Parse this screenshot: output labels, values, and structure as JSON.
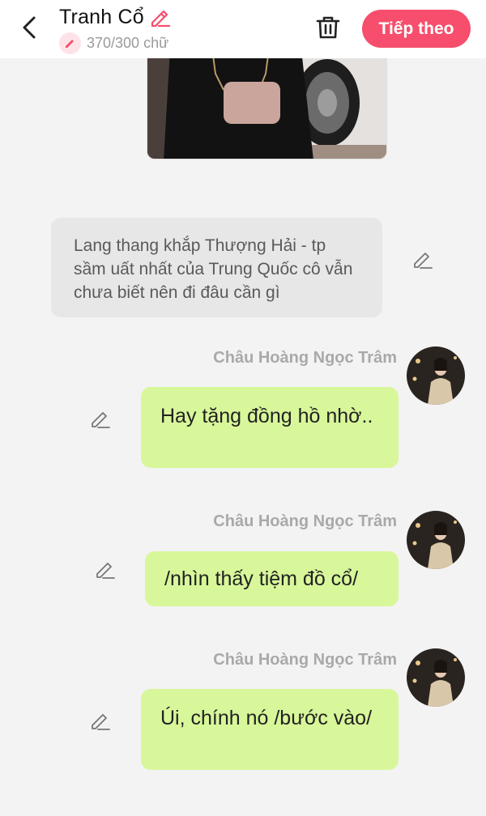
{
  "header": {
    "title": "Tranh Cổ",
    "char_count": "370/300 chữ",
    "next_label": "Tiếp theo",
    "accent_color": "#f64e6c"
  },
  "narration": {
    "text": "Lang thang khắp Thượng Hải - tp sầm uất nhất của Trung Quốc cô vẫn chưa biết nên đi đâu cần gì"
  },
  "messages": [
    {
      "sender": "Châu Hoàng Ngọc Trâm",
      "text": "Hay tặng đồng hồ nhờ.."
    },
    {
      "sender": "Châu Hoàng Ngọc Trâm",
      "text": "/nhìn thấy tiệm đồ cổ/"
    },
    {
      "sender": "Châu Hoàng Ngọc Trâm",
      "text": "Úi, chính nó /bước vào/"
    }
  ],
  "icons": {
    "back": "back-arrow-icon",
    "title_edit": "pencil-icon",
    "count": "pencil-icon",
    "delete": "trash-icon",
    "edit": "pencil-icon"
  },
  "colors": {
    "bubble": "#d8f79a",
    "narration_bg": "#e7e7e7",
    "background": "#f3f3f3"
  }
}
